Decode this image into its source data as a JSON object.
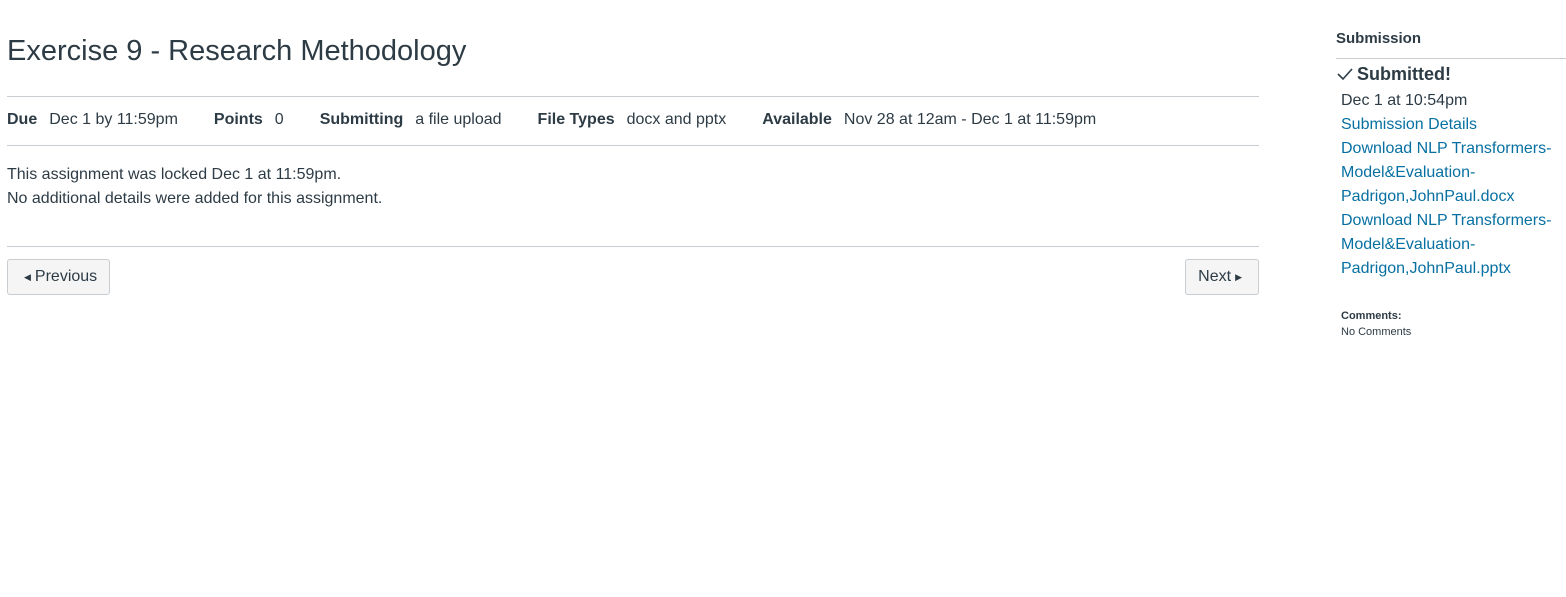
{
  "assignment": {
    "title": "Exercise 9 - Research Methodology",
    "details": {
      "due_label": "Due",
      "due_value": "Dec 1 by 11:59pm",
      "points_label": "Points",
      "points_value": "0",
      "submitting_label": "Submitting",
      "submitting_value": "a file upload",
      "file_types_label": "File Types",
      "file_types_value": "docx and pptx",
      "available_label": "Available",
      "available_value": "Nov 28 at 12am - Dec 1 at 11:59pm"
    },
    "locked_message": "This assignment was locked Dec 1 at 11:59pm.",
    "no_details_message": "No additional details were added for this assignment."
  },
  "navigation": {
    "previous_label": "Previous",
    "next_label": "Next"
  },
  "sidebar": {
    "heading": "Submission",
    "status": "Submitted!",
    "submitted_at": "Dec 1 at 10:54pm",
    "details_link": "Submission Details",
    "downloads": [
      "Download NLP Transformers-Model&Evaluation-Padrigon,JohnPaul.docx",
      "Download NLP Transformers-Model&Evaluation-Padrigon,JohnPaul.pptx"
    ],
    "comments_label": "Comments:",
    "comments_value": "No Comments"
  },
  "icons": {
    "check": "check-icon",
    "previous": "caret-left-icon",
    "next": "caret-right-icon"
  },
  "colors": {
    "text": "#2d3b45",
    "link": "#0770a3",
    "border": "#c7cdd1",
    "button_bg": "#f5f5f5"
  }
}
